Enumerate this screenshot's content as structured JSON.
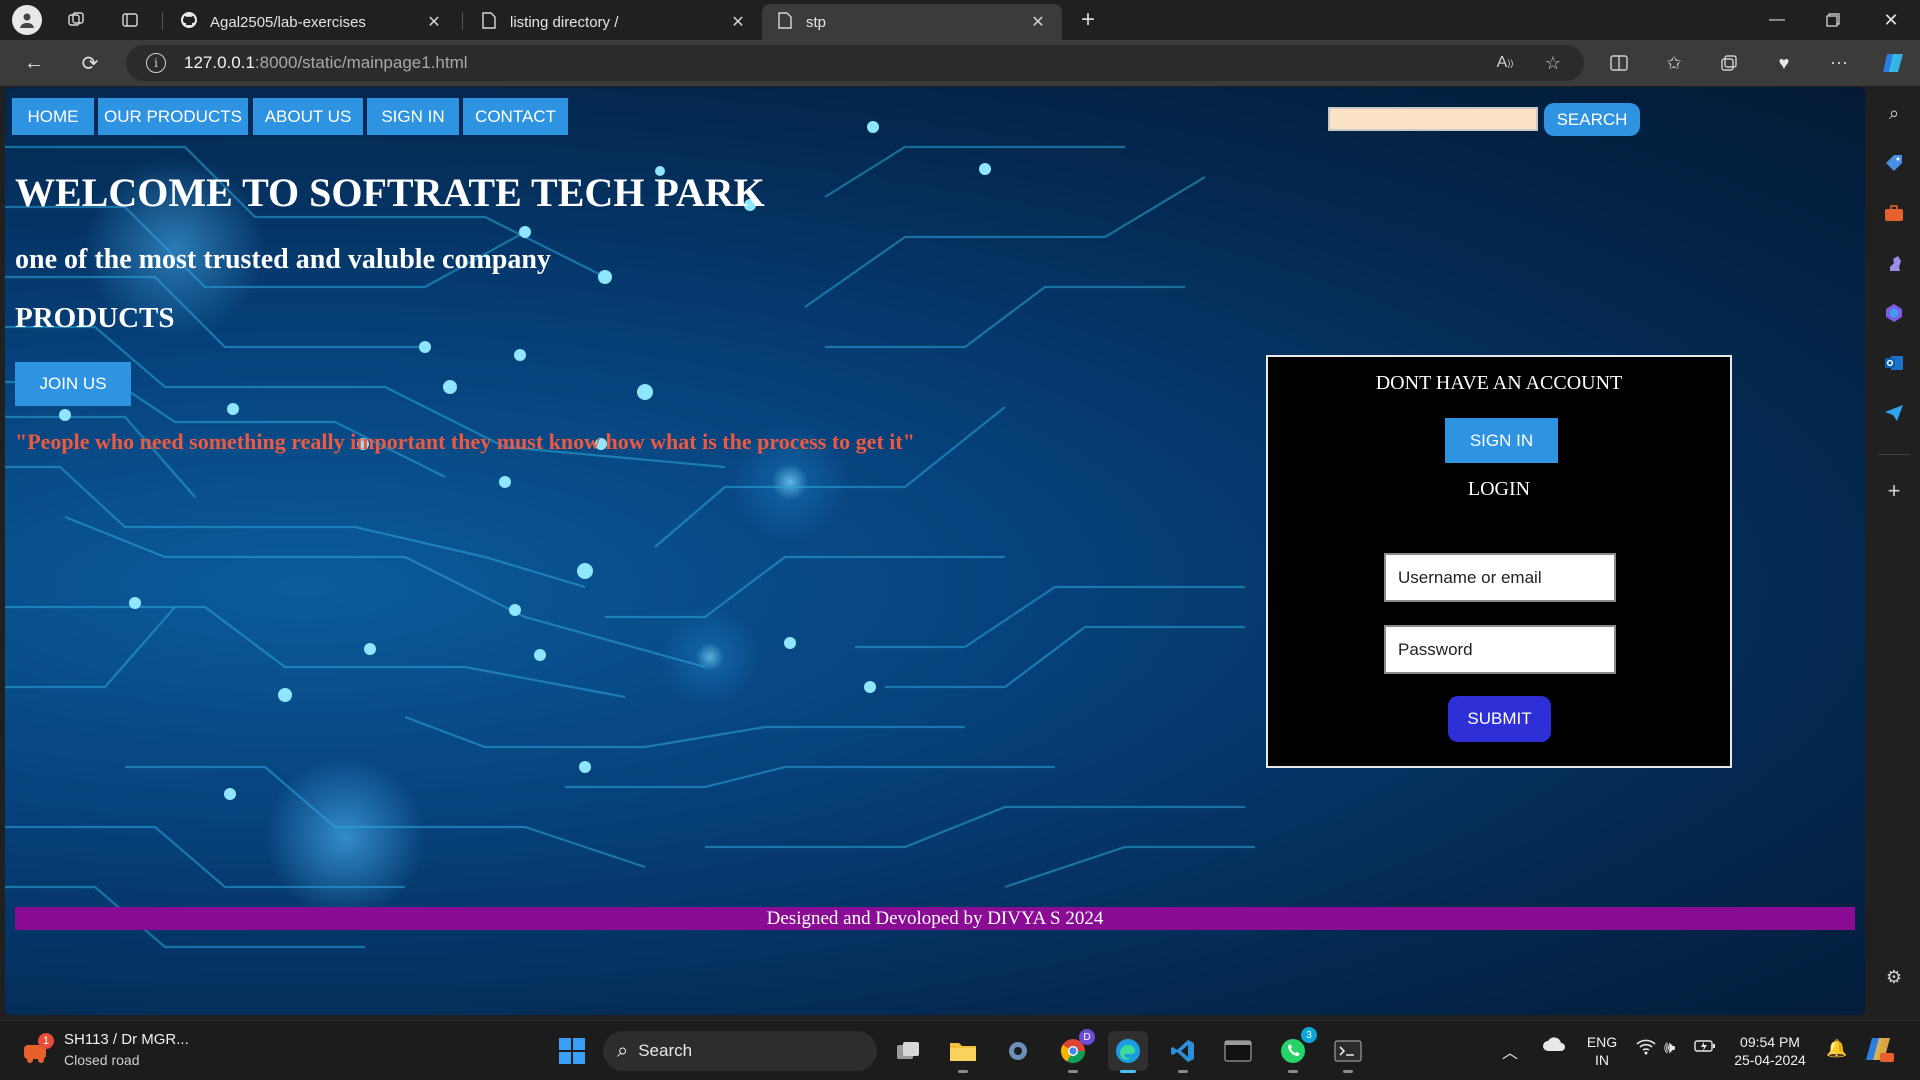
{
  "browser": {
    "tabs": [
      {
        "label": "Agal2505/lab-exercises",
        "icon": "github-icon"
      },
      {
        "label": "listing directory /",
        "icon": "page-icon"
      },
      {
        "label": "stp",
        "icon": "page-icon",
        "active": true
      }
    ],
    "url_host": "127.0.0.1",
    "url_path": ":8000/static/mainpage1.html"
  },
  "page": {
    "nav": [
      "HOME",
      "OUR PRODUCTS",
      "ABOUT US",
      "SIGN IN",
      "CONTACT"
    ],
    "search_button": "SEARCH",
    "welcome": "WELCOME TO SOFTRATE TECH PARK",
    "tagline": "one of the most trusted and valuble company",
    "products_heading": "PRODUCTS",
    "join_button": "JOIN US",
    "quote": "\"People who need something really important they must know how what is the process to get it\"",
    "card": {
      "no_account": "DONT HAVE AN ACCOUNT",
      "signin_button": "SIGN IN",
      "login_heading": "LOGIN",
      "username_placeholder": "Username or email",
      "password_placeholder": "Password",
      "submit_button": "SUBMIT"
    },
    "footer": "Designed and Devoloped by DIVYA S 2024"
  },
  "taskbar": {
    "traffic_title": "SH113 / Dr MGR...",
    "traffic_status": "Closed road",
    "traffic_badge": "1",
    "search_label": "Search",
    "lang_line1": "ENG",
    "lang_line2": "IN",
    "time": "09:54 PM",
    "date": "25-04-2024",
    "chrome_badge": "D",
    "whatsapp_badge": "3"
  },
  "colors": {
    "nav_button": "#2e93e0",
    "submit_button": "#2f2fd8",
    "footer_bar": "#8a0b94",
    "quote_text": "#f0593f",
    "search_box": "#fde3c6"
  }
}
